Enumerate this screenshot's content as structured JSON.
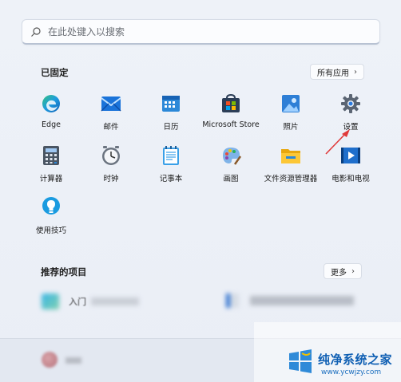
{
  "search": {
    "placeholder": "在此处键入以搜索",
    "icon": "search-icon"
  },
  "pinned": {
    "title": "已固定",
    "all_apps_label": "所有应用",
    "apps": [
      {
        "label": "Edge",
        "icon": "edge-icon"
      },
      {
        "label": "邮件",
        "icon": "mail-icon"
      },
      {
        "label": "日历",
        "icon": "calendar-icon"
      },
      {
        "label": "Microsoft Store",
        "icon": "store-icon"
      },
      {
        "label": "照片",
        "icon": "photos-icon"
      },
      {
        "label": "设置",
        "icon": "settings-gear-icon"
      },
      {
        "label": "计算器",
        "icon": "calculator-icon"
      },
      {
        "label": "时钟",
        "icon": "clock-icon"
      },
      {
        "label": "记事本",
        "icon": "notepad-icon"
      },
      {
        "label": "画图",
        "icon": "paint-icon"
      },
      {
        "label": "文件资源管理器",
        "icon": "file-explorer-icon"
      },
      {
        "label": "电影和电视",
        "icon": "movies-tv-icon"
      },
      {
        "label": "使用技巧",
        "icon": "tips-icon"
      }
    ]
  },
  "recommended": {
    "title": "推荐的项目",
    "more_label": "更多",
    "items": [
      {
        "label": "入门"
      },
      {
        "label": ""
      }
    ]
  },
  "watermark": {
    "title": "纯净系统之家",
    "url": "www.ycwjzy.com"
  },
  "colors": {
    "accent": "#0f5fb3",
    "arrow": "#e03a3a"
  }
}
